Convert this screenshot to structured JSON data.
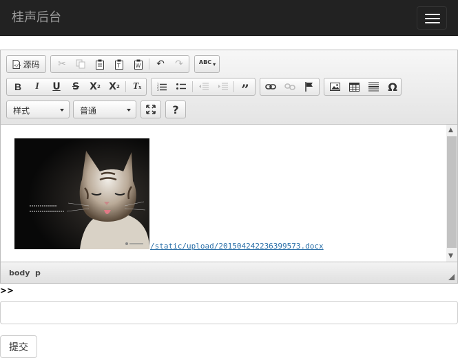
{
  "navbar": {
    "brand": "桂声后台",
    "menu_icon": "hamburger-icon"
  },
  "editor": {
    "toolbar": {
      "source_label": "源码",
      "style_combo": "样式",
      "format_combo": "普通",
      "help_label": "?"
    },
    "content": {
      "image_alt_icon": "cat-photo",
      "link_text": "/static/upload/201504242236399573.docx"
    },
    "footer": {
      "path": [
        "body",
        "p"
      ]
    }
  },
  "after_editor": {
    "marker": ">>"
  },
  "form": {
    "input_value": "",
    "submit_label": "提交"
  }
}
